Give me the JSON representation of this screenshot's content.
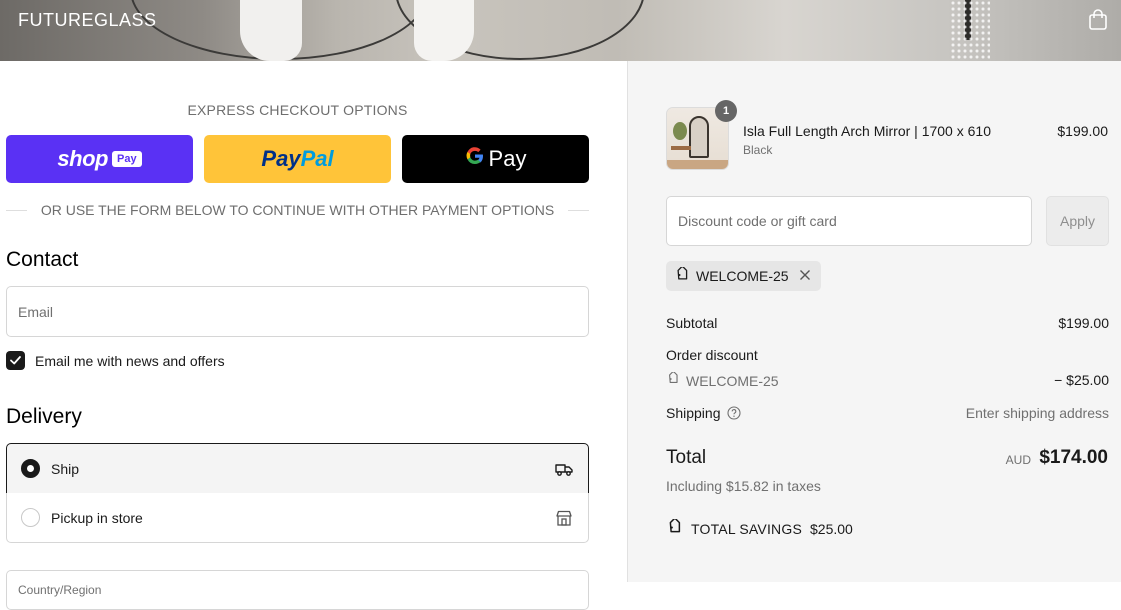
{
  "header": {
    "brand": "FUTUREGLASS"
  },
  "express": {
    "title": "EXPRESS CHECKOUT OPTIONS",
    "shop_pay": {
      "word": "shop",
      "badge": "Pay"
    },
    "paypal": {
      "part1": "Pay",
      "part2": "Pal"
    },
    "gpay": {
      "letter": "G",
      "word": "Pay"
    },
    "divider_text": "OR USE THE FORM BELOW TO CONTINUE WITH OTHER PAYMENT OPTIONS"
  },
  "contact": {
    "title": "Contact",
    "email_placeholder": "Email",
    "newsletter_label": "Email me with news and offers",
    "newsletter_checked": true
  },
  "delivery": {
    "title": "Delivery",
    "options": [
      {
        "label": "Ship",
        "selected": true,
        "icon": "truck-icon"
      },
      {
        "label": "Pickup in store",
        "selected": false,
        "icon": "store-icon"
      }
    ],
    "country_label": "Country/Region"
  },
  "order": {
    "item": {
      "name": "Isla Full Length Arch Mirror | 1700 x 610",
      "variant": "Black",
      "price": "$199.00",
      "quantity": "1"
    },
    "discount_placeholder": "Discount code or gift card",
    "apply_label": "Apply",
    "applied_code": "WELCOME-25",
    "subtotal_label": "Subtotal",
    "subtotal_value": "$199.00",
    "order_discount_label": "Order discount",
    "discount_code": "WELCOME-25",
    "discount_value": "− $25.00",
    "shipping_label": "Shipping",
    "shipping_value": "Enter shipping address",
    "total_label": "Total",
    "total_currency": "AUD",
    "total_value": "$174.00",
    "taxes_note": "Including $15.82 in taxes",
    "savings_label": "TOTAL SAVINGS",
    "savings_value": "$25.00"
  },
  "colors": {
    "shop_pay": "#5a31f4",
    "paypal": "#ffc439",
    "gpay": "#000000",
    "summary_bg": "#f5f5f5"
  }
}
